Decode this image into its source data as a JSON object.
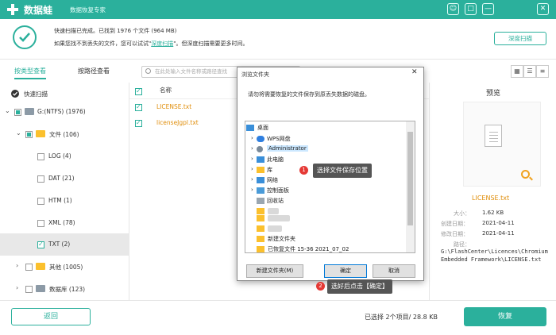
{
  "app": {
    "title": "数据蛙",
    "subtitle": "数据恢复专家",
    "win_controls": [
      "☺",
      "□",
      "—",
      "✕"
    ]
  },
  "status": {
    "line1": "快速扫描已完成。已找到 1976 个文件 (964 MB)",
    "line2_pre": "如果您找不到丢失的文件，您可以试试",
    "line2_link": "深度扫描",
    "line2_post": "。但深度扫描需要更多时间。",
    "deep_scan_button": "深度扫描"
  },
  "tabs": {
    "by_type": "按类型查看",
    "by_path": "按路径查看"
  },
  "tree": {
    "quick_scan": "快速扫描",
    "drive": "G:(NTFS) (1976)",
    "doc": "文件 (106)",
    "log": "LOG (4)",
    "dat": "DAT (21)",
    "htm": "HTM (1)",
    "xml": "XML (78)",
    "txt": "TXT (2)",
    "other": "其他 (1005)",
    "database": "数据库 (123)"
  },
  "search": {
    "placeholder": "在此处输入文件名称或路径查找"
  },
  "columns": {
    "name": "名称"
  },
  "files": [
    "LICENSE.txt",
    "licenseJgpl.txt"
  ],
  "preview": {
    "title": "预览",
    "name": "LICENSE.txt",
    "size_k": "大小：",
    "size_v": "1.62 KB",
    "created_k": "创建日期：",
    "created_v": "2021-04-11",
    "modified_k": "修改日期：",
    "modified_v": "2021-04-11",
    "path_k": "路径：",
    "path_v": "G:\\FlashCenter\\Licences\\Chromium Embedded Framework\\LICENSE.txt"
  },
  "footer": {
    "back": "返回",
    "selected": "已选择 2个项目/ 28.8 KB",
    "recover": "恢复"
  },
  "dialog": {
    "title": "浏览文件夹",
    "desc": "请勿将需要恢复的文件保存到原丢失数据的磁盘。",
    "items": [
      "桌面",
      "WPS网盘",
      "Administrator",
      "此电脑",
      "库",
      "网络",
      "控制面板",
      "回收站",
      "新建文件夹",
      "已恢复文件 15-36 2021_07_02"
    ],
    "new_folder": "新建文件夹(M)",
    "ok": "确定",
    "cancel": "取消"
  },
  "callouts": {
    "step1_num": "1",
    "step1": "选择文件保存位置",
    "step2_num": "2",
    "step2": "选好后点击【确定】"
  },
  "colors": {
    "accent": "#2bb09c",
    "orange": "#e08e0b",
    "badge": "#e53935"
  }
}
